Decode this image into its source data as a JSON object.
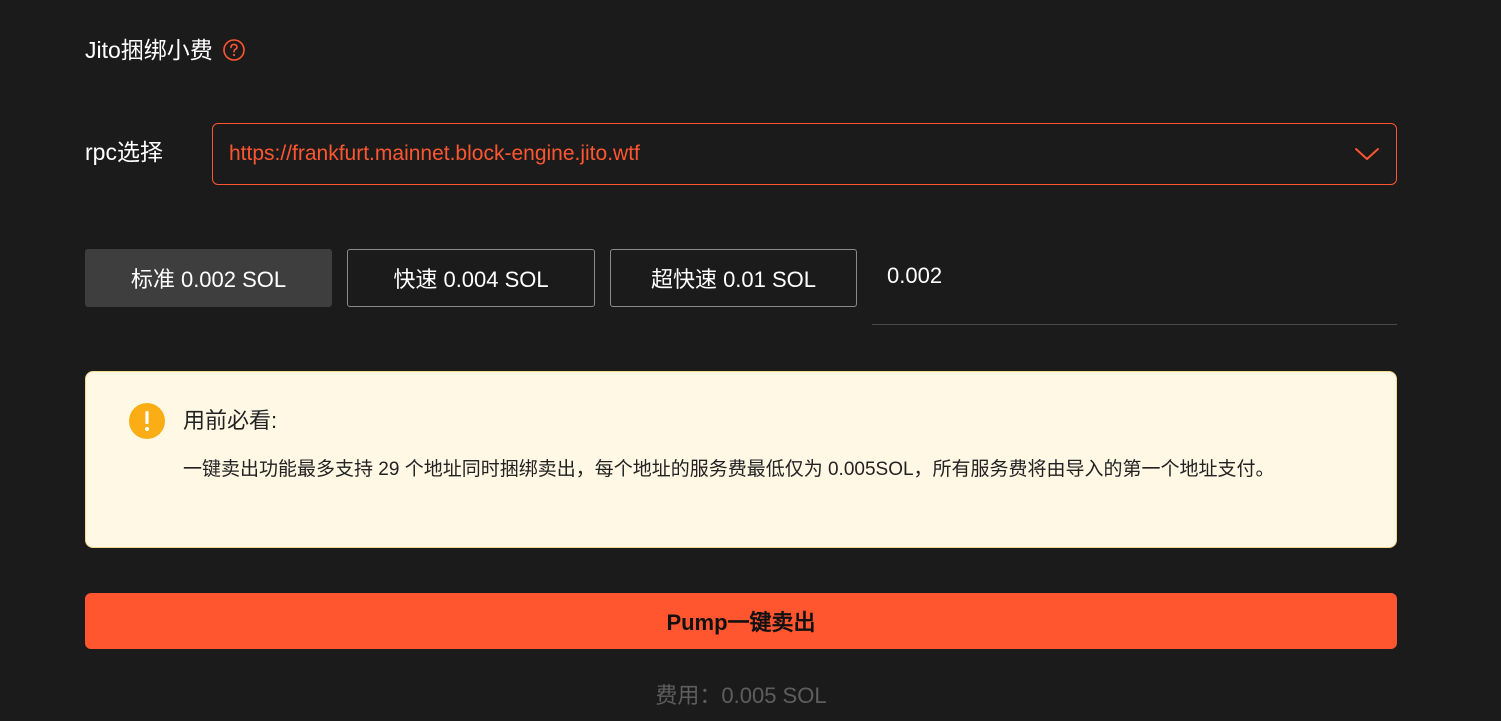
{
  "jito": {
    "title": "Jito捆绑小费",
    "help_icon": "question-circle-icon"
  },
  "rpc": {
    "label": "rpc选择",
    "selected": "https://frankfurt.mainnet.block-engine.jito.wtf",
    "dropdown_icon": "chevron-down-icon"
  },
  "fees": {
    "options": [
      {
        "label": "标准 0.002 SOL",
        "active": true
      },
      {
        "label": "快速 0.004 SOL",
        "active": false
      },
      {
        "label": "超快速 0.01 SOL",
        "active": false
      }
    ],
    "custom_value": "0.002"
  },
  "notice": {
    "icon": "exclamation-circle-icon",
    "title": "用前必看:",
    "body": "一键卖出功能最多支持 29 个地址同时捆绑卖出，每个地址的服务费最低仅为 0.005SOL，所有服务费将由导入的第一个地址支付。"
  },
  "action": {
    "sell_label": "Pump一键卖出"
  },
  "cost": {
    "text": "费用：0.005 SOL"
  },
  "colors": {
    "accent": "#ff5630",
    "background": "#1b1b1b",
    "notice_bg": "#fff8e5",
    "warning": "#faad14"
  }
}
